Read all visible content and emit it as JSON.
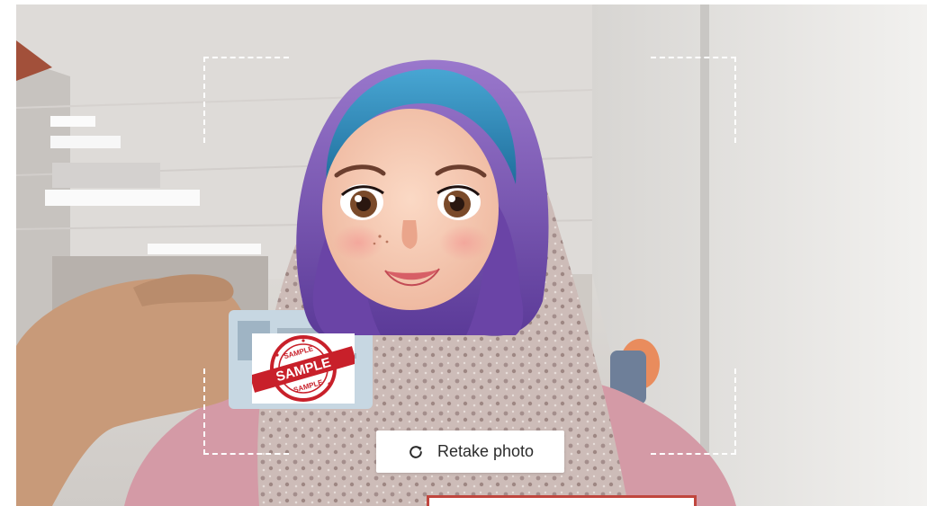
{
  "camera": {
    "stamp_text_main": "SAMPLE",
    "stamp_text_small": "SAMPLE"
  },
  "actions": {
    "retake_label": "Retake photo",
    "retake_icon": "refresh-icon"
  },
  "colors": {
    "stamp_red": "#c8202a",
    "hijab_purple": "#7b4fb0",
    "hijab_inner": "#2f88b8",
    "button_text": "#2b2b2b",
    "bottom_accent": "#c0463e"
  }
}
